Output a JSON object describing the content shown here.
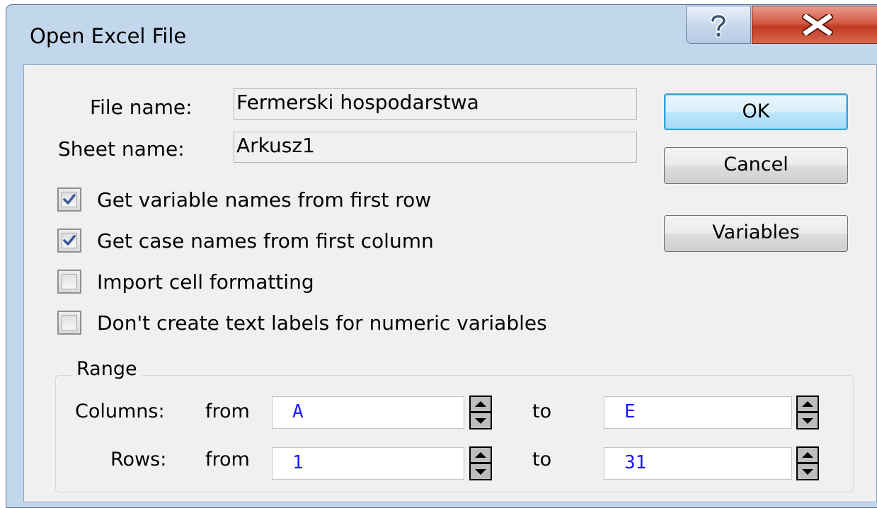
{
  "window": {
    "title": "Open Excel File",
    "help_glyph": "?"
  },
  "form": {
    "file_label": "File name:",
    "file_value": "Fermerski hospodarstwa",
    "sheet_label": "Sheet name:",
    "sheet_value": "Arkusz1"
  },
  "buttons": {
    "ok": "OK",
    "cancel": "Cancel",
    "variables": "Variables"
  },
  "options": [
    {
      "label": "Get variable names from first row",
      "checked": true
    },
    {
      "label": "Get case names from first column",
      "checked": true
    },
    {
      "label": "Import cell formatting",
      "checked": false
    },
    {
      "label": "Don't create text labels for numeric variables",
      "checked": false
    }
  ],
  "range": {
    "title": "Range",
    "columns_label": "Columns:",
    "rows_label": "Rows:",
    "from_label": "from",
    "to_label": "to",
    "columns_from": "A",
    "columns_to": "E",
    "rows_from": "1",
    "rows_to": "31"
  },
  "colors": {
    "frame": "#c3d7ec",
    "client": "#f0f0f0",
    "close_red": "#c13a22",
    "default_button_border": "#3c9fd8",
    "input_text": "#1a1aff"
  },
  "icons": {
    "help": "question-mark-icon",
    "close": "close-x-icon",
    "check": "checkmark-icon",
    "spin_up": "triangle-up-icon",
    "spin_down": "triangle-down-icon"
  }
}
